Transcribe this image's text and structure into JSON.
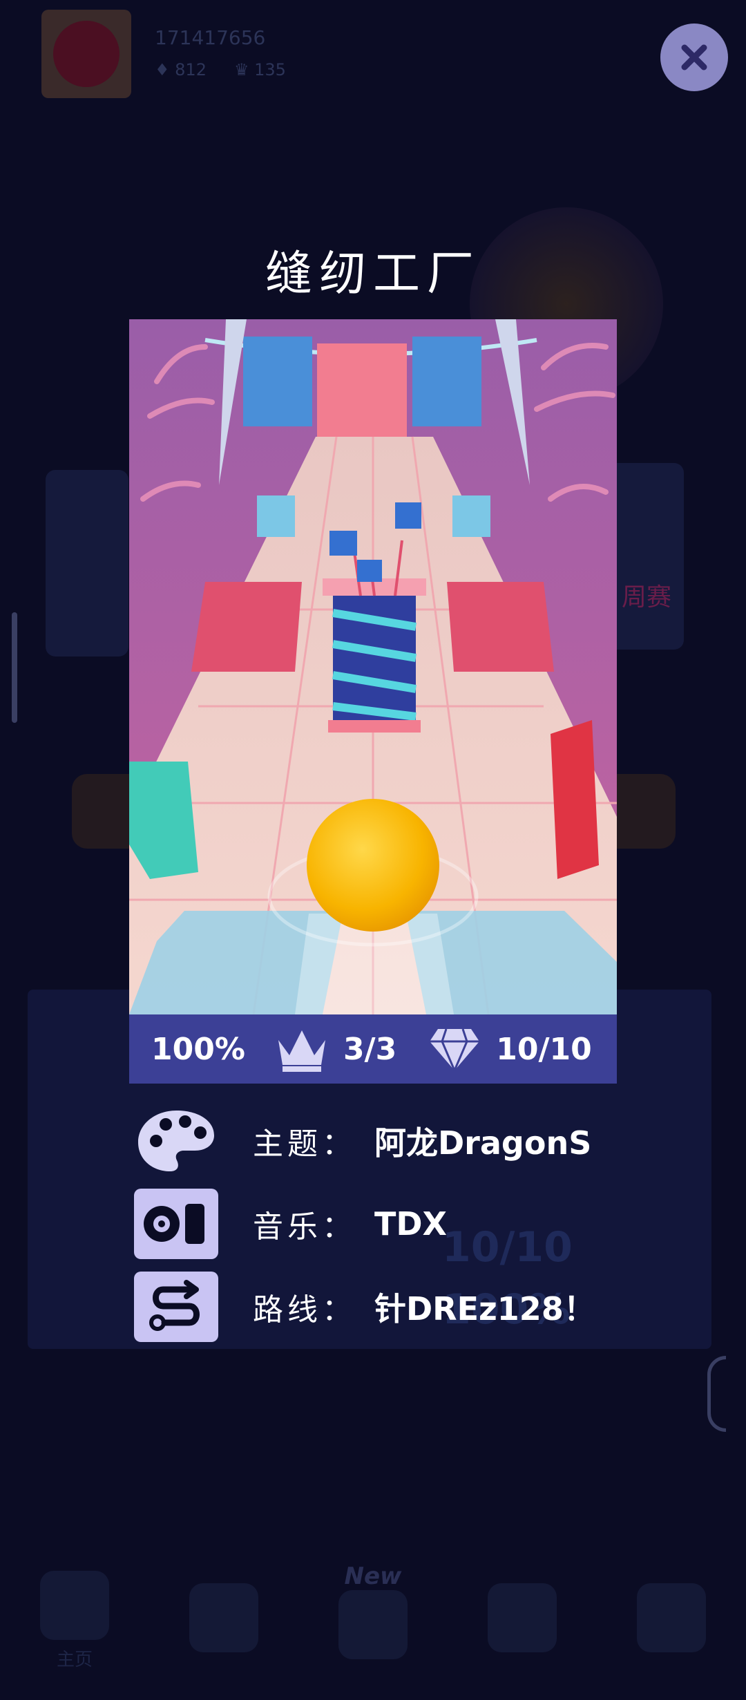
{
  "background": {
    "profile": {
      "player_id": "171417656",
      "gems": "812",
      "crowns": "135"
    },
    "event_label": "周赛",
    "level_panel": {
      "gems_progress": "10/10",
      "percent": "100%"
    },
    "nav": {
      "home": "主页",
      "new_badge": "New"
    }
  },
  "modal": {
    "title": "缝纫工厂",
    "stats": {
      "percent": "100%",
      "crowns": "3/3",
      "gems": "10/10"
    },
    "info": {
      "theme_label": "主题：",
      "theme_value": "阿龙DragonS",
      "music_label": "音乐：",
      "music_value": "TDX",
      "route_label": "路线：",
      "route_value": "针DREz128！"
    }
  },
  "colors": {
    "overlay": "#0b0c24",
    "stats_bar": "#3c4096",
    "icon_tile": "#c9c4f3",
    "close_button": "#8a88c4",
    "ball": "#f8b400"
  },
  "icons": {
    "close": "close-icon",
    "crown": "crown-icon",
    "gem": "gem-icon",
    "theme": "palette-icon",
    "music": "music-player-icon",
    "route": "route-icon"
  }
}
